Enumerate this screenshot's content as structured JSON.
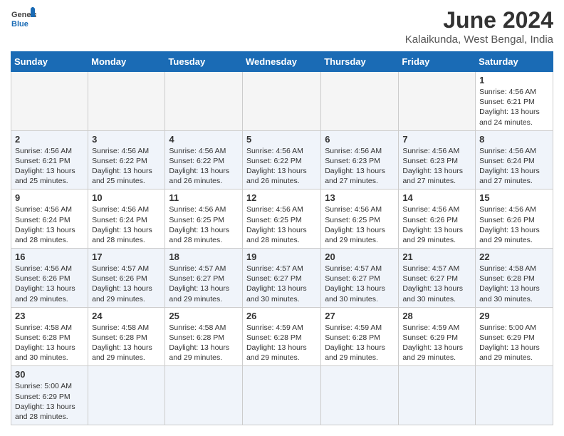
{
  "header": {
    "logo_general": "General",
    "logo_blue": "Blue",
    "month_year": "June 2024",
    "location": "Kalaikunda, West Bengal, India"
  },
  "weekdays": [
    "Sunday",
    "Monday",
    "Tuesday",
    "Wednesday",
    "Thursday",
    "Friday",
    "Saturday"
  ],
  "weeks": [
    {
      "days": [
        {
          "number": "",
          "info": ""
        },
        {
          "number": "",
          "info": ""
        },
        {
          "number": "",
          "info": ""
        },
        {
          "number": "",
          "info": ""
        },
        {
          "number": "",
          "info": ""
        },
        {
          "number": "",
          "info": ""
        },
        {
          "number": "1",
          "info": "Sunrise: 4:56 AM\nSunset: 6:21 PM\nDaylight: 13 hours and 24 minutes."
        }
      ]
    },
    {
      "days": [
        {
          "number": "2",
          "info": "Sunrise: 4:56 AM\nSunset: 6:21 PM\nDaylight: 13 hours and 25 minutes."
        },
        {
          "number": "3",
          "info": "Sunrise: 4:56 AM\nSunset: 6:22 PM\nDaylight: 13 hours and 25 minutes."
        },
        {
          "number": "4",
          "info": "Sunrise: 4:56 AM\nSunset: 6:22 PM\nDaylight: 13 hours and 26 minutes."
        },
        {
          "number": "5",
          "info": "Sunrise: 4:56 AM\nSunset: 6:22 PM\nDaylight: 13 hours and 26 minutes."
        },
        {
          "number": "6",
          "info": "Sunrise: 4:56 AM\nSunset: 6:23 PM\nDaylight: 13 hours and 27 minutes."
        },
        {
          "number": "7",
          "info": "Sunrise: 4:56 AM\nSunset: 6:23 PM\nDaylight: 13 hours and 27 minutes."
        },
        {
          "number": "8",
          "info": "Sunrise: 4:56 AM\nSunset: 6:24 PM\nDaylight: 13 hours and 27 minutes."
        }
      ]
    },
    {
      "days": [
        {
          "number": "9",
          "info": "Sunrise: 4:56 AM\nSunset: 6:24 PM\nDaylight: 13 hours and 28 minutes."
        },
        {
          "number": "10",
          "info": "Sunrise: 4:56 AM\nSunset: 6:24 PM\nDaylight: 13 hours and 28 minutes."
        },
        {
          "number": "11",
          "info": "Sunrise: 4:56 AM\nSunset: 6:25 PM\nDaylight: 13 hours and 28 minutes."
        },
        {
          "number": "12",
          "info": "Sunrise: 4:56 AM\nSunset: 6:25 PM\nDaylight: 13 hours and 28 minutes."
        },
        {
          "number": "13",
          "info": "Sunrise: 4:56 AM\nSunset: 6:25 PM\nDaylight: 13 hours and 29 minutes."
        },
        {
          "number": "14",
          "info": "Sunrise: 4:56 AM\nSunset: 6:26 PM\nDaylight: 13 hours and 29 minutes."
        },
        {
          "number": "15",
          "info": "Sunrise: 4:56 AM\nSunset: 6:26 PM\nDaylight: 13 hours and 29 minutes."
        }
      ]
    },
    {
      "days": [
        {
          "number": "16",
          "info": "Sunrise: 4:56 AM\nSunset: 6:26 PM\nDaylight: 13 hours and 29 minutes."
        },
        {
          "number": "17",
          "info": "Sunrise: 4:57 AM\nSunset: 6:26 PM\nDaylight: 13 hours and 29 minutes."
        },
        {
          "number": "18",
          "info": "Sunrise: 4:57 AM\nSunset: 6:27 PM\nDaylight: 13 hours and 29 minutes."
        },
        {
          "number": "19",
          "info": "Sunrise: 4:57 AM\nSunset: 6:27 PM\nDaylight: 13 hours and 30 minutes."
        },
        {
          "number": "20",
          "info": "Sunrise: 4:57 AM\nSunset: 6:27 PM\nDaylight: 13 hours and 30 minutes."
        },
        {
          "number": "21",
          "info": "Sunrise: 4:57 AM\nSunset: 6:27 PM\nDaylight: 13 hours and 30 minutes."
        },
        {
          "number": "22",
          "info": "Sunrise: 4:58 AM\nSunset: 6:28 PM\nDaylight: 13 hours and 30 minutes."
        }
      ]
    },
    {
      "days": [
        {
          "number": "23",
          "info": "Sunrise: 4:58 AM\nSunset: 6:28 PM\nDaylight: 13 hours and 30 minutes."
        },
        {
          "number": "24",
          "info": "Sunrise: 4:58 AM\nSunset: 6:28 PM\nDaylight: 13 hours and 29 minutes."
        },
        {
          "number": "25",
          "info": "Sunrise: 4:58 AM\nSunset: 6:28 PM\nDaylight: 13 hours and 29 minutes."
        },
        {
          "number": "26",
          "info": "Sunrise: 4:59 AM\nSunset: 6:28 PM\nDaylight: 13 hours and 29 minutes."
        },
        {
          "number": "27",
          "info": "Sunrise: 4:59 AM\nSunset: 6:28 PM\nDaylight: 13 hours and 29 minutes."
        },
        {
          "number": "28",
          "info": "Sunrise: 4:59 AM\nSunset: 6:29 PM\nDaylight: 13 hours and 29 minutes."
        },
        {
          "number": "29",
          "info": "Sunrise: 5:00 AM\nSunset: 6:29 PM\nDaylight: 13 hours and 29 minutes."
        }
      ]
    },
    {
      "days": [
        {
          "number": "30",
          "info": "Sunrise: 5:00 AM\nSunset: 6:29 PM\nDaylight: 13 hours and 28 minutes."
        },
        {
          "number": "",
          "info": ""
        },
        {
          "number": "",
          "info": ""
        },
        {
          "number": "",
          "info": ""
        },
        {
          "number": "",
          "info": ""
        },
        {
          "number": "",
          "info": ""
        },
        {
          "number": "",
          "info": ""
        }
      ]
    }
  ]
}
